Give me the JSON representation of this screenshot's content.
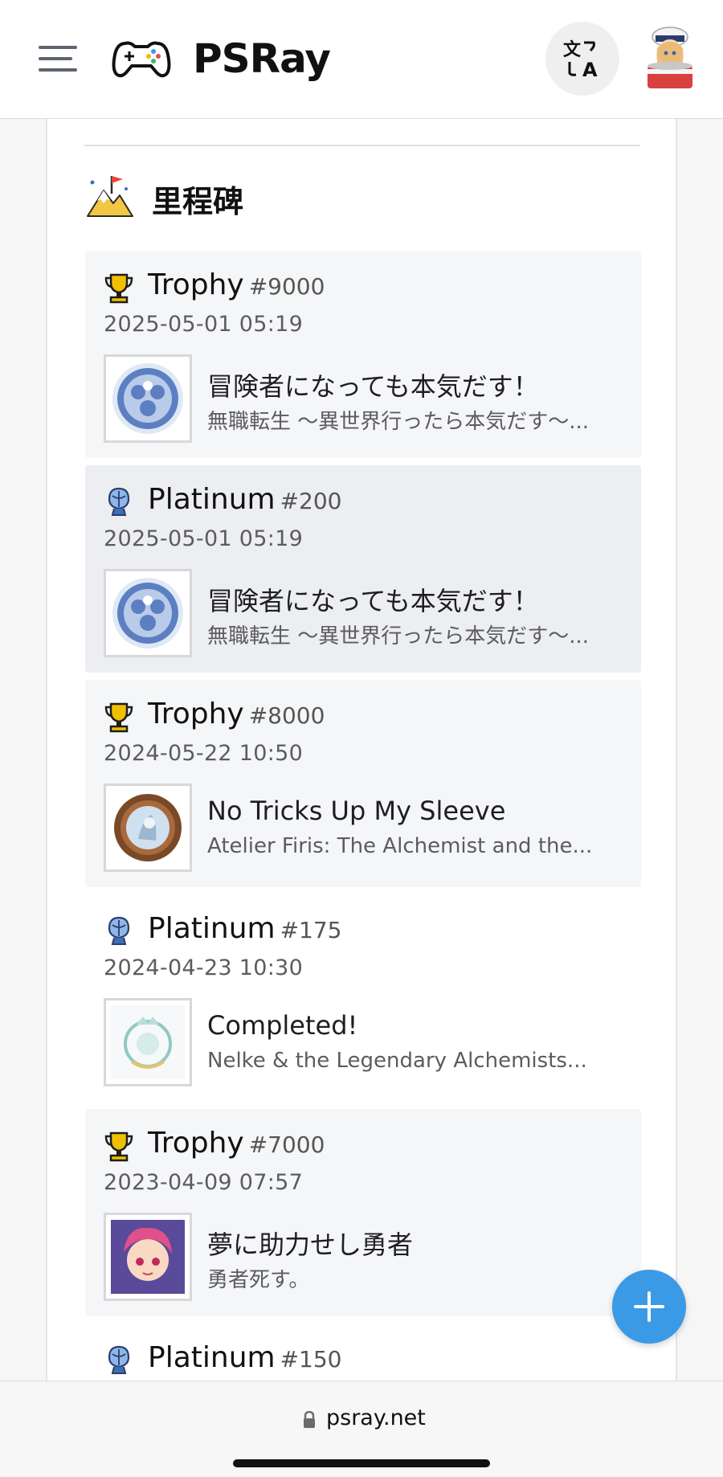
{
  "app": {
    "brand": "PSRay"
  },
  "section": {
    "title": "里程碑"
  },
  "milestones": [
    {
      "type": "Trophy",
      "number": "#9000",
      "date": "2025-05-01 05:19",
      "trophy_name": "冒険者になっても本気だす！",
      "game": "無職転生 ～異世界行ったら本気だす～..."
    },
    {
      "type": "Platinum",
      "number": "#200",
      "date": "2025-05-01 05:19",
      "trophy_name": "冒険者になっても本気だす！",
      "game": "無職転生 ～異世界行ったら本気だす～..."
    },
    {
      "type": "Trophy",
      "number": "#8000",
      "date": "2024-05-22 10:50",
      "trophy_name": "No Tricks Up My Sleeve",
      "game": "Atelier Firis: The Alchemist and the..."
    },
    {
      "type": "Platinum",
      "number": "#175",
      "date": "2024-04-23 10:30",
      "trophy_name": "Completed!",
      "game": "Nelke & the Legendary Alchemists..."
    },
    {
      "type": "Trophy",
      "number": "#7000",
      "date": "2023-04-09 07:57",
      "trophy_name": "夢に助力せし勇者",
      "game": "勇者死す。"
    },
    {
      "type": "Platinum",
      "number": "#150"
    }
  ],
  "browser": {
    "url": "psray.net"
  },
  "icons": {
    "menu": "hamburger-menu-icon",
    "logo": "gamepad-icon",
    "language": "translate-icon",
    "section": "mountain-flag-icon",
    "trophy": "gold-trophy-icon",
    "platinum": "platinum-trophy-icon",
    "add": "plus-icon",
    "lock": "lock-icon"
  },
  "colors": {
    "accent": "#3a9ae6",
    "trophy_gold": "#e6b400",
    "platinum_blue": "#3d6fb6"
  }
}
